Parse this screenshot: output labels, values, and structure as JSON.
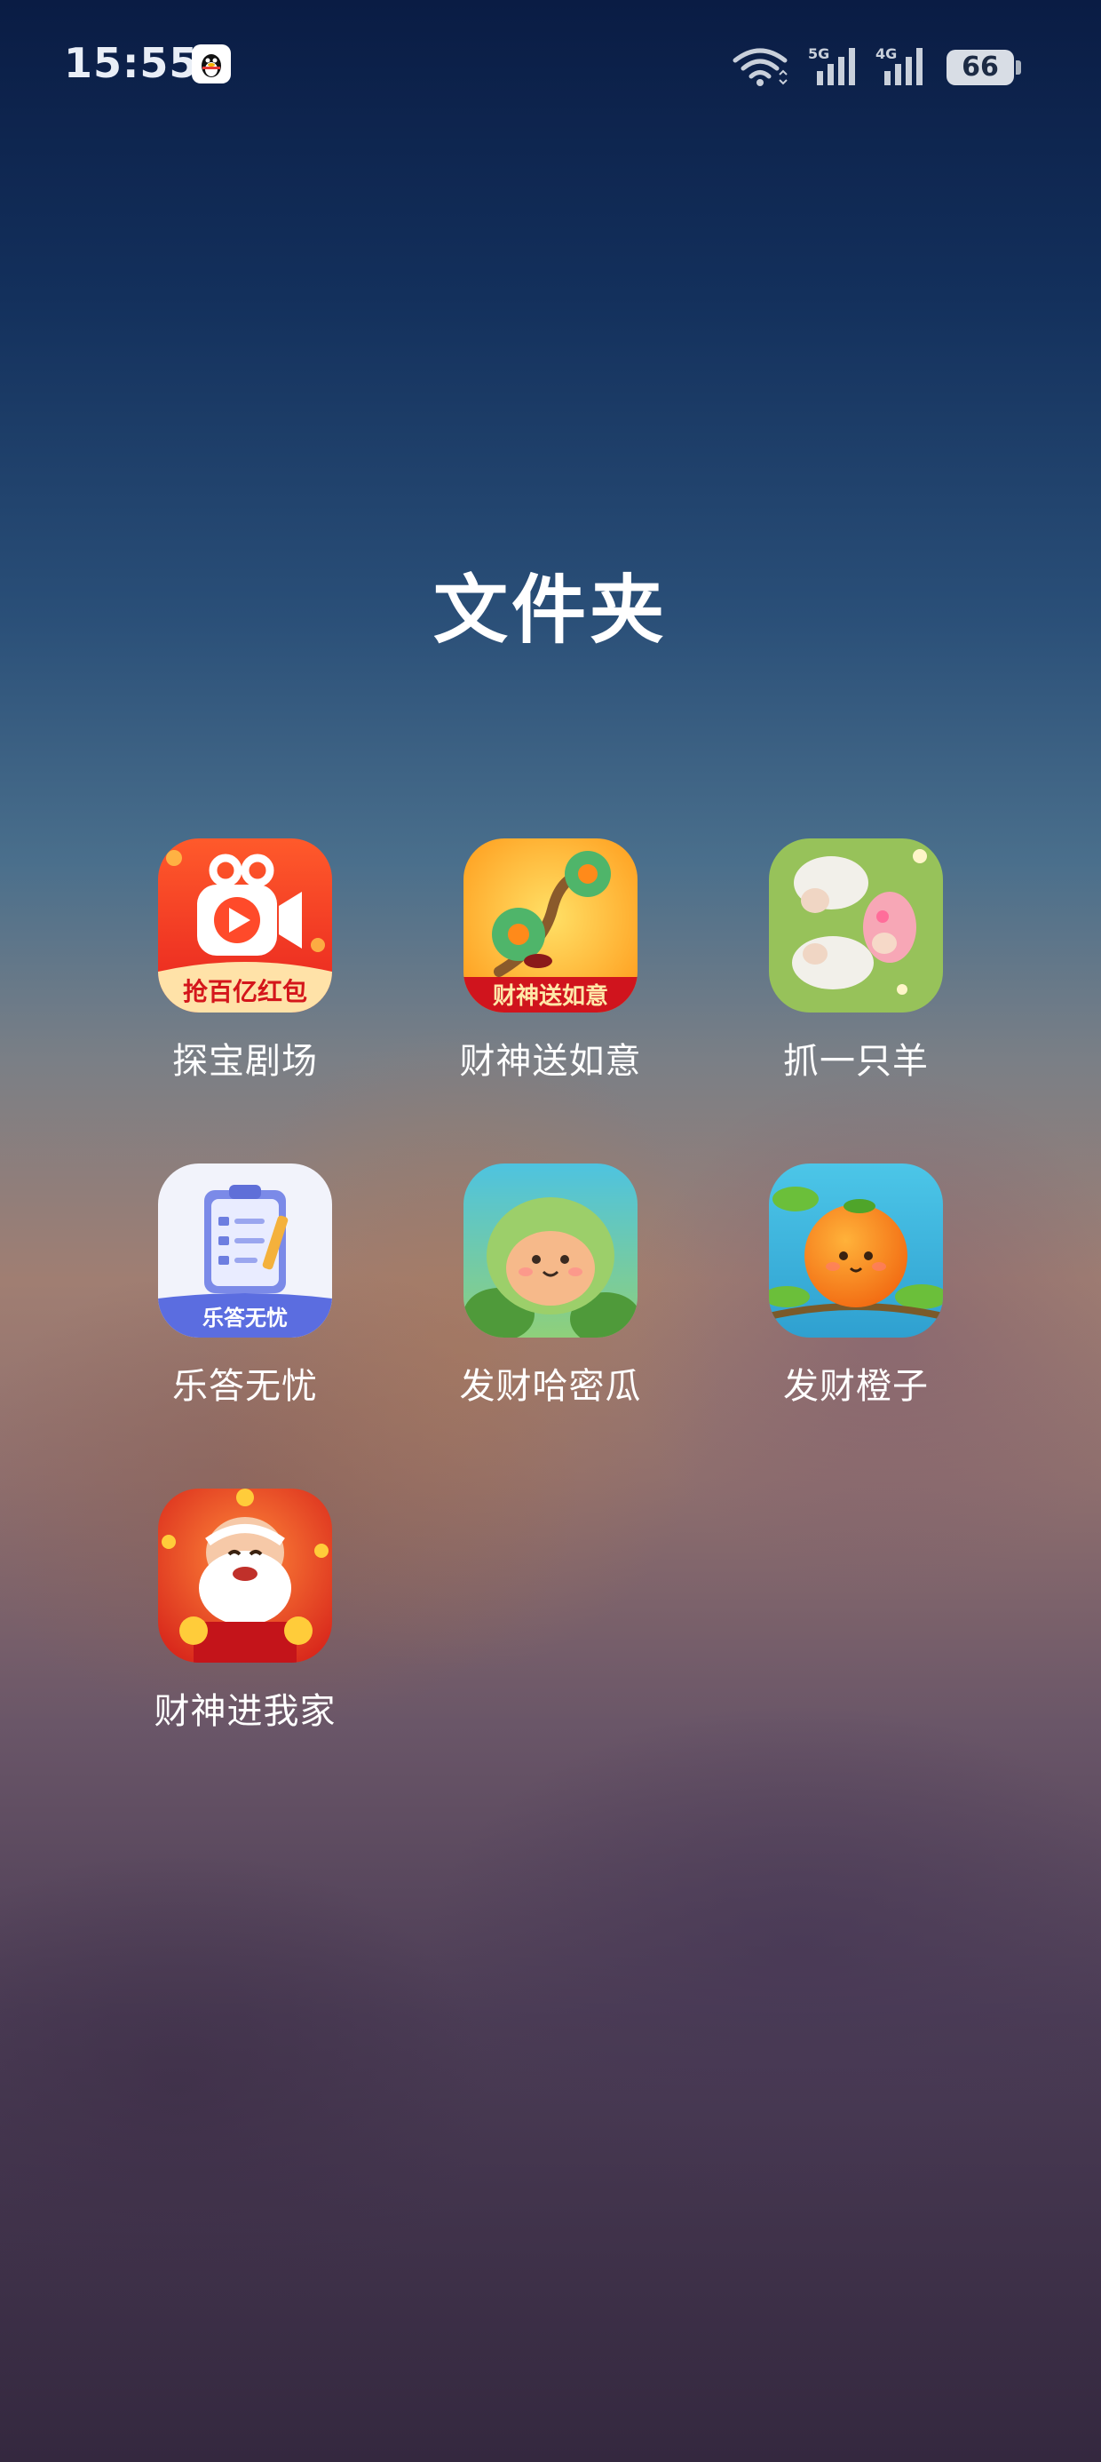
{
  "status_bar": {
    "time": "15:55",
    "notification_icon": "qq-penguin-icon",
    "network_5g": "5G",
    "network_4g": "4G",
    "battery": "66"
  },
  "folder": {
    "title": "文件夹",
    "apps": [
      {
        "label": "探宝剧场",
        "icon": "video-camera-play-icon",
        "banner": "抢百亿红包"
      },
      {
        "label": "财神送如意",
        "icon": "ruyi-jade-icon",
        "banner": "财神送如意"
      },
      {
        "label": "抓一只羊",
        "icon": "sheep-game-icon"
      },
      {
        "label": "乐答无忧",
        "icon": "clipboard-quiz-icon",
        "banner": "乐答无忧"
      },
      {
        "label": "发财哈密瓜",
        "icon": "melon-character-icon"
      },
      {
        "label": "发财橙子",
        "icon": "orange-character-icon"
      },
      {
        "label": "财神进我家",
        "icon": "god-of-wealth-icon"
      }
    ]
  },
  "colors": {
    "text": "#ffffff",
    "status_text": "#e9eef6"
  }
}
